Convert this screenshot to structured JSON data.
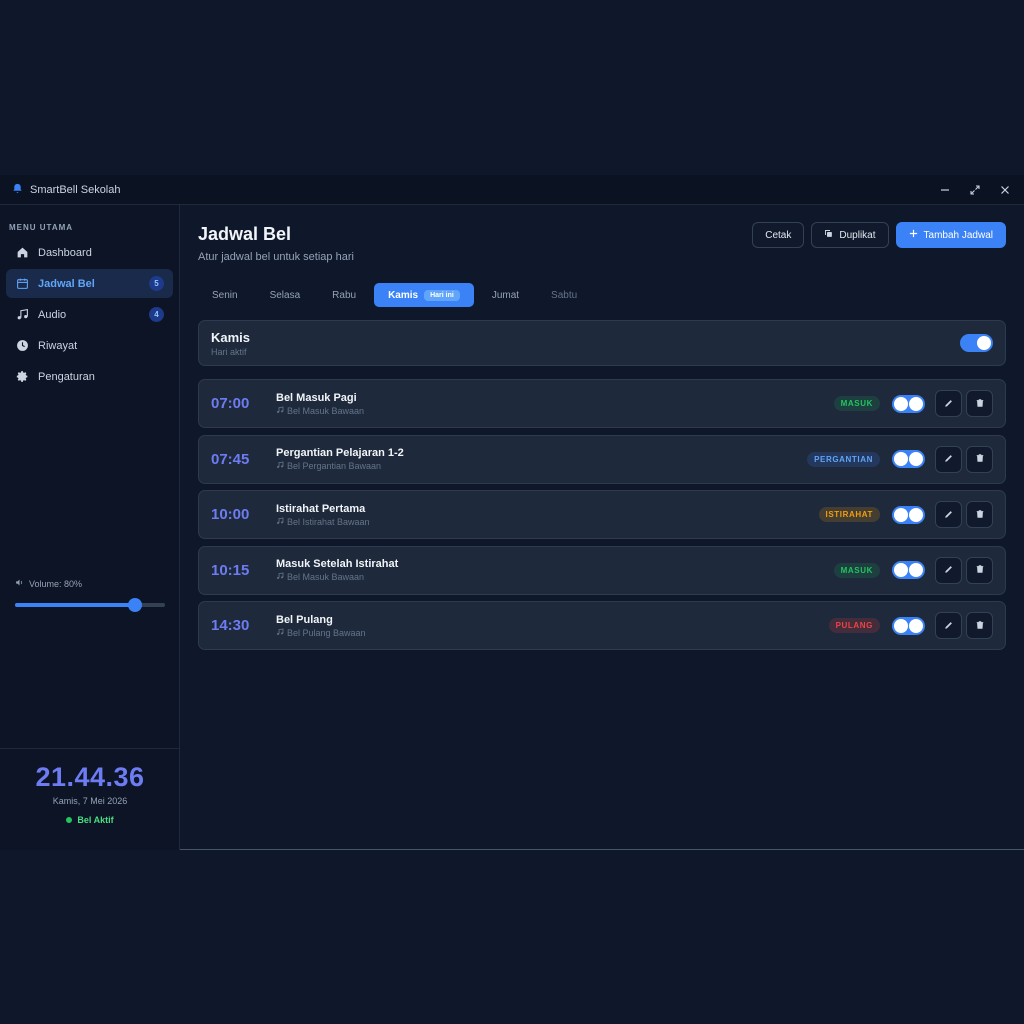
{
  "app": {
    "title": "SmartBell Sekolah"
  },
  "sidebar": {
    "heading": "MENU UTAMA",
    "items": [
      {
        "label": "Dashboard",
        "icon": "home-icon",
        "badge": ""
      },
      {
        "label": "Jadwal Bel",
        "icon": "calendar-icon",
        "badge": "5",
        "active": true
      },
      {
        "label": "Audio",
        "icon": "music-icon",
        "badge": "4"
      },
      {
        "label": "Riwayat",
        "icon": "clock-icon",
        "badge": ""
      },
      {
        "label": "Pengaturan",
        "icon": "gear-icon",
        "badge": ""
      }
    ],
    "volume": {
      "label": "Volume: 80%",
      "value": 80
    },
    "clock": {
      "time": "21.44.36",
      "date": "Kamis, 7 Mei 2026",
      "status": "Bel Aktif"
    }
  },
  "main": {
    "title": "Jadwal Bel",
    "subtitle": "Atur jadwal bel untuk setiap hari",
    "actions": {
      "print": "Cetak",
      "duplicate": "Duplikat",
      "add": "Tambah Jadwal"
    },
    "tabs": [
      {
        "label": "Senin"
      },
      {
        "label": "Selasa"
      },
      {
        "label": "Rabu"
      },
      {
        "label": "Kamis",
        "active": true,
        "chip": "Hari ini"
      },
      {
        "label": "Jumat"
      },
      {
        "label": "Sabtu",
        "dim": true
      }
    ],
    "day": {
      "name": "Kamis",
      "status": "Hari aktif",
      "enabled": true
    },
    "schedule": [
      {
        "time": "07:00",
        "name": "Bel Masuk Pagi",
        "audio": "Bel Masuk Bawaan",
        "tag": "MASUK"
      },
      {
        "time": "07:45",
        "name": "Pergantian Pelajaran 1-2",
        "audio": "Bel Pergantian Bawaan",
        "tag": "PERGANTIAN"
      },
      {
        "time": "10:00",
        "name": "Istirahat Pertama",
        "audio": "Bel Istirahat Bawaan",
        "tag": "ISTIRAHAT"
      },
      {
        "time": "10:15",
        "name": "Masuk Setelah Istirahat",
        "audio": "Bel Masuk Bawaan",
        "tag": "MASUK"
      },
      {
        "time": "14:30",
        "name": "Bel Pulang",
        "audio": "Bel Pulang Bawaan",
        "tag": "PULANG"
      }
    ]
  },
  "colors": {
    "accent": "#3b82f6",
    "time": "#6d7cf2",
    "tag_masuk": "#22c55e",
    "tag_pergantian": "#3b82f6",
    "tag_istirahat": "#f59e0b",
    "tag_pulang": "#ef4444"
  }
}
